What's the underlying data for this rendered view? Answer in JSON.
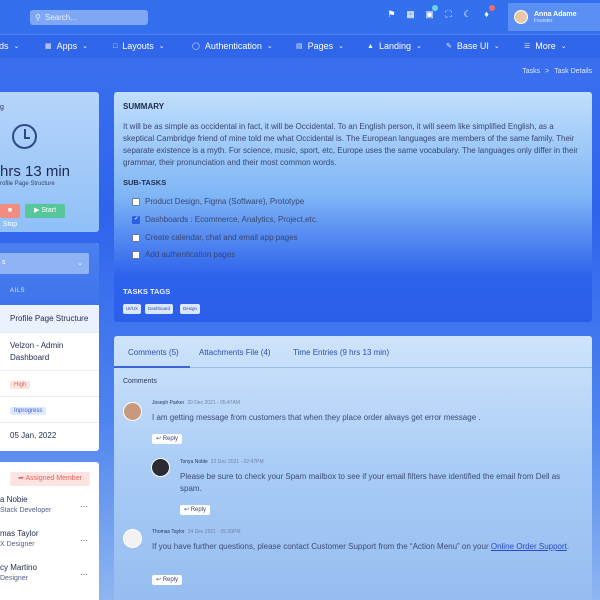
{
  "topbar": {
    "search_placeholder": "Search...",
    "user": {
      "name": "Anna Adame",
      "role": "Founder"
    }
  },
  "nav": [
    {
      "label": "rds",
      "icon": "dashboard-icon"
    },
    {
      "label": "Apps",
      "icon": "apps-icon"
    },
    {
      "label": "Layouts",
      "icon": "layouts-icon"
    },
    {
      "label": "Authentication",
      "icon": "account-circle-icon"
    },
    {
      "label": "Pages",
      "icon": "pages-icon"
    },
    {
      "label": "Landing",
      "icon": "rocket-icon"
    },
    {
      "label": "Base UI",
      "icon": "pencil-ruler-icon"
    },
    {
      "label": "More",
      "icon": "file-list-icon"
    }
  ],
  "breadcrumb": {
    "parent": "Tasks",
    "current": "Task Details"
  },
  "timer": {
    "label": "g",
    "time": "hrs 13 min",
    "subtitle": "rofile Page Structure",
    "stop": "Stop",
    "start": "Start"
  },
  "details": {
    "select_value": "s",
    "section_label": "AILS",
    "task_title": "Profile Page Structure",
    "project": "Velzon - Admin Dashboard",
    "priority": "High",
    "status": "Inprogress",
    "due_date": "05 Jan, 2022"
  },
  "members": {
    "assign_label": "Assigned Member",
    "list": [
      {
        "name": "a Nobie",
        "role": "Stack Developer"
      },
      {
        "name": "mas Taylor",
        "role": "X Designer"
      },
      {
        "name": "cy Martino",
        "role": "Designer"
      }
    ]
  },
  "summary": {
    "title": "SUMMARY",
    "text": "It will be as simple as occidental in fact, it will be Occidental. To an English person, it will seem like simplified English, as a skeptical Cambridge friend of mine told me what Occidental is. The European languages are members of the same family. Their separate existence is a myth. For science, music, sport, etc, Europe uses the same vocabulary. The languages only differ in their grammar, their pronunciation and their most common words.",
    "subtasks_title": "SUB-TASKS",
    "subtasks": [
      {
        "label": "Product Design, Figma (Software), Prototype",
        "checked": false
      },
      {
        "label": "Dashboards : Ecommerce, Analytics, Project,etc.",
        "checked": true
      },
      {
        "label": "Create calendar, chat and email app pages",
        "checked": false
      },
      {
        "label": "Add authentication pages",
        "checked": false
      }
    ],
    "tags_title": "TASKS TAGS",
    "tags": [
      "UI/UX",
      "Dashboard",
      "Design"
    ]
  },
  "comments": {
    "tabs": [
      "Comments (5)",
      "Attachments File (4)",
      "Time Entries (9 hrs 13 min)"
    ],
    "heading": "Comments",
    "reply_label": "Reply",
    "items": [
      {
        "author": "Joseph Parker",
        "time": "20 Dec 2021 - 05:47AM",
        "text": "I am getting message from customers that when they place order always get error message ."
      },
      {
        "author": "Tonya Noble",
        "time": "22 Dec 2021 - 02:47PM",
        "text": "Please be sure to check your Spam mailbox to see if your email filters have identified the email from Dell as spam."
      },
      {
        "author": "Thomas Taylor",
        "time": "24 Dec 2021 - 05:20PM",
        "text_before": "If you have further questions, please contact Customer Support from the “Action Menu” on your ",
        "link": "Online Order Support",
        "text_after": "."
      }
    ]
  },
  "colors": {
    "accent": "#2f66ea",
    "stop": "#f28b80",
    "start": "#56c79b",
    "danger": "#e56257"
  }
}
